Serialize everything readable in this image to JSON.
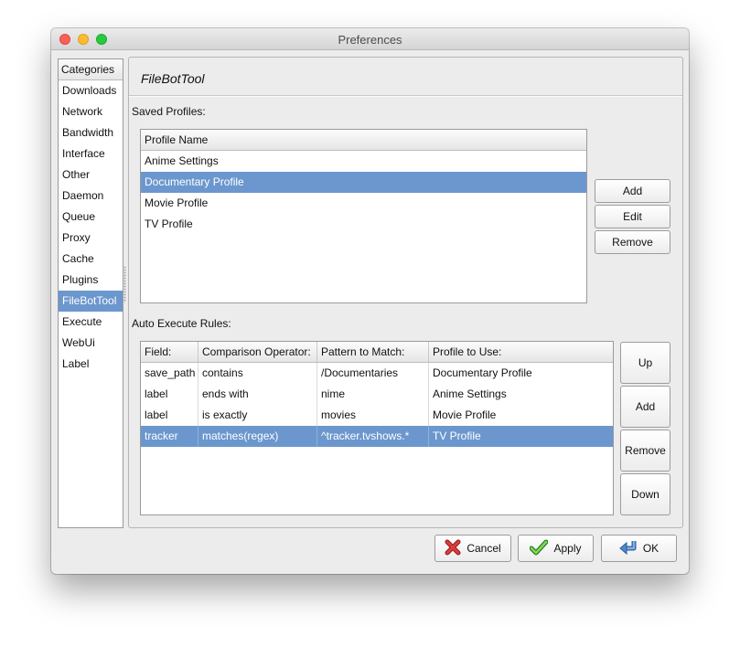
{
  "window": {
    "title": "Preferences"
  },
  "categories": {
    "header": "Categories",
    "items": [
      "Downloads",
      "Network",
      "Bandwidth",
      "Interface",
      "Other",
      "Daemon",
      "Queue",
      "Proxy",
      "Cache",
      "Plugins",
      "FileBotTool",
      "Execute",
      "WebUi",
      "Label"
    ],
    "selected_index": 10
  },
  "panel": {
    "title": "FileBotTool",
    "saved_profiles_label": "Saved Profiles:",
    "profiles": {
      "header": "Profile Name",
      "rows": [
        "Anime Settings",
        "Documentary Profile",
        "Movie Profile",
        "TV Profile"
      ],
      "selected_index": 1
    },
    "profile_buttons": {
      "add": "Add",
      "edit": "Edit",
      "remove": "Remove"
    },
    "rules_label": "Auto Execute Rules:",
    "rules": {
      "headers": [
        "Field:",
        "Comparison Operator:",
        "Pattern to Match:",
        "Profile to Use:"
      ],
      "rows": [
        [
          "save_path",
          "contains",
          "/Documentaries",
          "Documentary Profile"
        ],
        [
          "label",
          "ends with",
          "nime",
          "Anime Settings"
        ],
        [
          "label",
          "is exactly",
          "movies",
          "Movie Profile"
        ],
        [
          "tracker",
          "matches(regex)",
          "^tracker.tvshows.*",
          "TV Profile"
        ]
      ],
      "selected_index": 3
    },
    "rule_buttons": {
      "up": "Up",
      "add": "Add",
      "remove": "Remove",
      "down": "Down"
    }
  },
  "footer": {
    "cancel": "Cancel",
    "apply": "Apply",
    "ok": "OK"
  },
  "colors": {
    "selection": "#6b97ce",
    "close": "#fc5f57",
    "minimize": "#fdbc2e",
    "maximize": "#28c840"
  },
  "icons": {
    "cancel": "red-x-icon",
    "apply": "green-check-icon",
    "ok": "blue-return-arrow-icon"
  }
}
